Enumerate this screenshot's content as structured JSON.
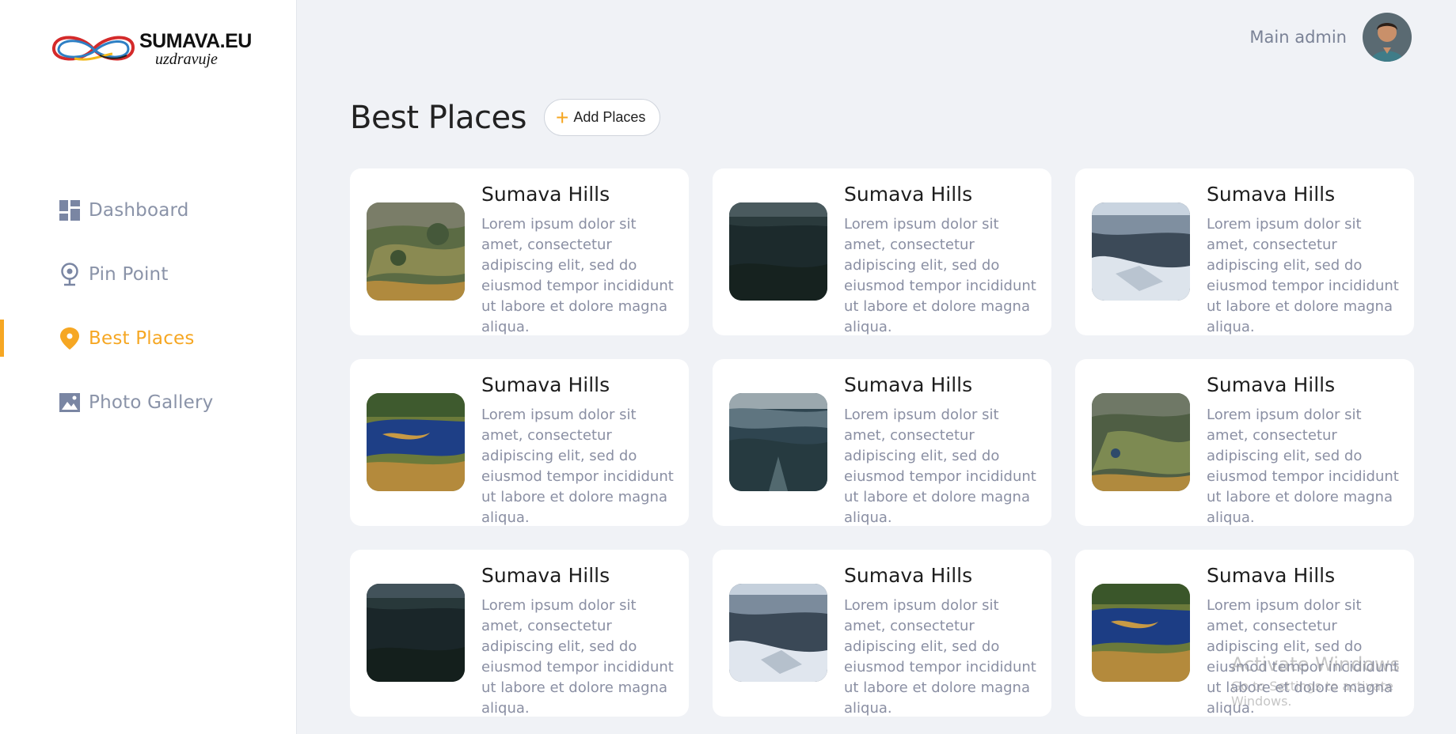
{
  "brand": {
    "title": "SUMAVA.EU",
    "subtitle": "uzdravuje"
  },
  "sidebar": {
    "items": [
      {
        "label": "Dashboard",
        "icon": "dashboard-icon",
        "active": false
      },
      {
        "label": "Pin Point",
        "icon": "pin-point-icon",
        "active": false
      },
      {
        "label": "Best Places",
        "icon": "location-marker-icon",
        "active": true
      },
      {
        "label": "Photo Gallery",
        "icon": "image-icon",
        "active": false
      }
    ]
  },
  "header": {
    "user_name": "Main admin"
  },
  "main": {
    "title": "Best Places",
    "add_button_label": "Add Places",
    "cards": [
      {
        "title": "Sumava Hills",
        "description": "Lorem ipsum dolor sit amet, consectetur adipiscing elit, sed do eiusmod tempor incididunt ut labore et dolore magna aliqua.",
        "image": "aerial-forest-meadow"
      },
      {
        "title": "Sumava Hills",
        "description": "Lorem ipsum dolor sit amet, consectetur adipiscing elit, sed do eiusmod tempor incididunt ut labore et dolore magna aliqua.",
        "image": "dark-forest"
      },
      {
        "title": "Sumava Hills",
        "description": "Lorem ipsum dolor sit amet, consectetur adipiscing elit, sed do eiusmod tempor incididunt ut labore et dolore magna aliqua.",
        "image": "snowy-forest"
      },
      {
        "title": "Sumava Hills",
        "description": "Lorem ipsum dolor sit amet, consectetur adipiscing elit, sed do eiusmod tempor incididunt ut labore et dolore magna aliqua.",
        "image": "bog-lake"
      },
      {
        "title": "Sumava Hills",
        "description": "Lorem ipsum dolor sit amet, consectetur adipiscing elit, sed do eiusmod tempor incididunt ut labore et dolore magna aliqua.",
        "image": "misty-hills"
      },
      {
        "title": "Sumava Hills",
        "description": "Lorem ipsum dolor sit amet, consectetur adipiscing elit, sed do eiusmod tempor incididunt ut labore et dolore magna aliqua.",
        "image": "aerial-forest-meadow"
      },
      {
        "title": "Sumava Hills",
        "description": "Lorem ipsum dolor sit amet, consectetur adipiscing elit, sed do eiusmod tempor incididunt ut labore et dolore magna aliqua.",
        "image": "dark-forest"
      },
      {
        "title": "Sumava Hills",
        "description": "Lorem ipsum dolor sit amet, consectetur adipiscing elit, sed do eiusmod tempor incididunt ut labore et dolore magna aliqua.",
        "image": "snowy-forest"
      },
      {
        "title": "Sumava Hills",
        "description": "Lorem ipsum dolor sit amet, consectetur adipiscing elit, sed do eiusmod tempor incididunt ut labore et dolore magna aliqua.",
        "image": "bog-lake"
      }
    ]
  },
  "watermark": {
    "line1": "Activate Windows",
    "line2": "Go to Settings to activate Windows."
  },
  "colors": {
    "accent": "#f6a723",
    "muted": "#8a93a8",
    "background": "#f0f2f6"
  }
}
